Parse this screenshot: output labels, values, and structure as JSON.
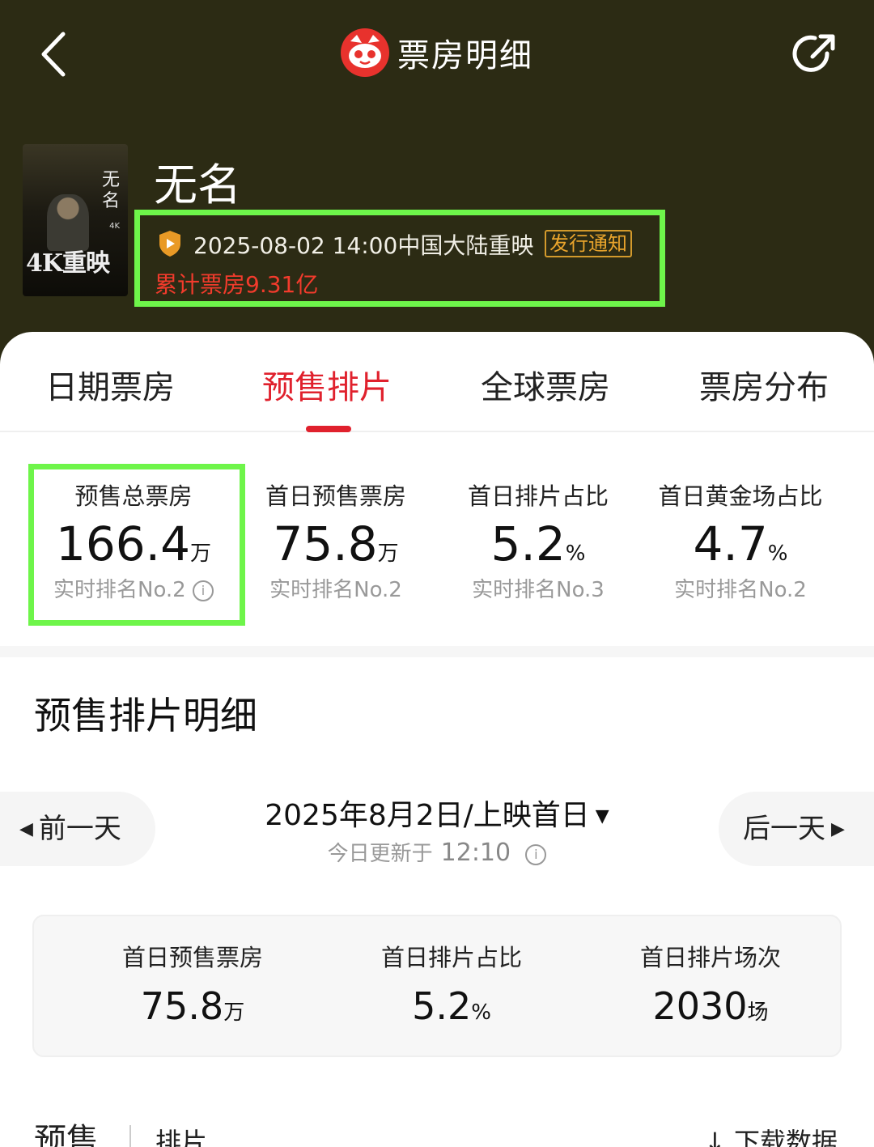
{
  "header": {
    "title": "票房明细",
    "colors": {
      "background": "#2c2b14",
      "accent": "#e0212d",
      "highlight": "#6ef54a"
    }
  },
  "poster": {
    "vertical_title": "无名",
    "small_tag": "4K",
    "big_tag": "4K重映"
  },
  "movie": {
    "name": "无名",
    "release": "2025-08-02 14:00中国大陆重映",
    "notice": "发行通知",
    "total_boxoffice": "累计票房9.31亿"
  },
  "tabs": [
    {
      "label": "日期票房"
    },
    {
      "label": "预售排片",
      "active": true
    },
    {
      "label": "全球票房"
    },
    {
      "label": "票房分布"
    }
  ],
  "stats": [
    {
      "label": "预售总票房",
      "value": "166.4",
      "unit": "万",
      "rank": "实时排名No.2"
    },
    {
      "label": "首日预售票房",
      "value": "75.8",
      "unit": "万",
      "rank": "实时排名No.2"
    },
    {
      "label": "首日排片占比",
      "value": "5.2",
      "unit": "%",
      "rank": "实时排名No.3"
    },
    {
      "label": "首日黄金场占比",
      "value": "4.7",
      "unit": "%",
      "rank": "实时排名No.2"
    }
  ],
  "section": {
    "title": "预售排片明细",
    "prev_day": "前一天",
    "next_day": "后一天",
    "date": "2025年8月2日/上映首日",
    "update_label": "今日更新于",
    "update_time": "12:10"
  },
  "summary": [
    {
      "label": "首日预售票房",
      "value": "75.8",
      "unit": "万"
    },
    {
      "label": "首日排片占比",
      "value": "5.2",
      "unit": "%"
    },
    {
      "label": "首日排片场次",
      "value": "2030",
      "unit": "场"
    }
  ],
  "bottom": {
    "tab1": "预售",
    "tab2": "排片",
    "download": "下载数据"
  }
}
